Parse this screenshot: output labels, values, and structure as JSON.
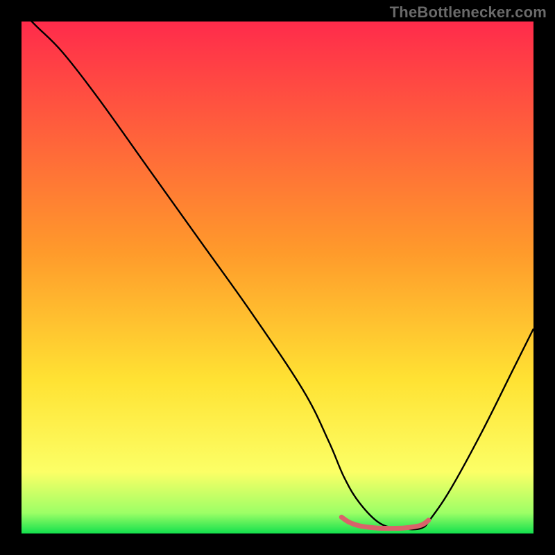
{
  "watermark": "TheBottlenecker.com",
  "chart_data": {
    "type": "line",
    "title": "",
    "xlabel": "",
    "ylabel": "",
    "xlim": [
      0,
      100
    ],
    "ylim": [
      0,
      100
    ],
    "gradient_stops": [
      {
        "offset": 0.0,
        "color": "#ff2b4b"
      },
      {
        "offset": 0.45,
        "color": "#ff9a2b"
      },
      {
        "offset": 0.7,
        "color": "#ffe233"
      },
      {
        "offset": 0.88,
        "color": "#fcff66"
      },
      {
        "offset": 0.96,
        "color": "#9cff66"
      },
      {
        "offset": 1.0,
        "color": "#13e04d"
      }
    ],
    "series": [
      {
        "name": "bottleneck-curve",
        "color": "#000000",
        "x": [
          0,
          3,
          8,
          15,
          25,
          35,
          45,
          55,
          60,
          63,
          66,
          70,
          74,
          78,
          80,
          84,
          90,
          96,
          100
        ],
        "values": [
          102,
          99,
          94,
          85,
          71,
          57,
          43,
          28,
          18,
          11,
          6,
          2,
          1,
          1,
          3,
          9,
          20,
          32,
          40
        ]
      },
      {
        "name": "optimal-range",
        "color": "#d9636a",
        "stroke_width": 7,
        "linecap": "round",
        "x": [
          62.5,
          64,
          66,
          69,
          72,
          75,
          78,
          79.5
        ],
        "values": [
          3.2,
          2.2,
          1.5,
          1.1,
          1.0,
          1.1,
          1.6,
          2.6
        ]
      }
    ]
  }
}
